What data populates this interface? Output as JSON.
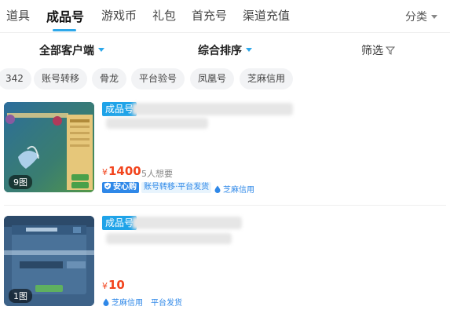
{
  "nav": {
    "tabs": [
      "道具",
      "成品号",
      "游戏币",
      "礼包",
      "首充号",
      "渠道充值"
    ],
    "active_tab": "成品号",
    "more_label": "分类"
  },
  "filters": {
    "client": "全部客户端",
    "sort": "综合排序",
    "screen": "筛选"
  },
  "chips": [
    "342",
    "账号转移",
    "骨龙",
    "平台验号",
    "凤凰号",
    "芝麻信用"
  ],
  "listings": [
    {
      "image_count": "9图",
      "type_tag": "成品号",
      "price_currency": "¥",
      "price": "1400",
      "wants": "5人想要",
      "secure_label": "安心购",
      "transfer_label": "账号转移·平台发货",
      "zhima_label": "芝麻信用"
    },
    {
      "image_count": "1图",
      "type_tag": "成品号",
      "price_currency": "¥",
      "price": "10",
      "zhima_label": "芝麻信用",
      "platform_label": "平台发货"
    }
  ],
  "colors": {
    "accent": "#2ea8ea",
    "price": "#f2441d",
    "tag_blue": "#1fa3e8",
    "badge_blue": "#2f88e8"
  }
}
